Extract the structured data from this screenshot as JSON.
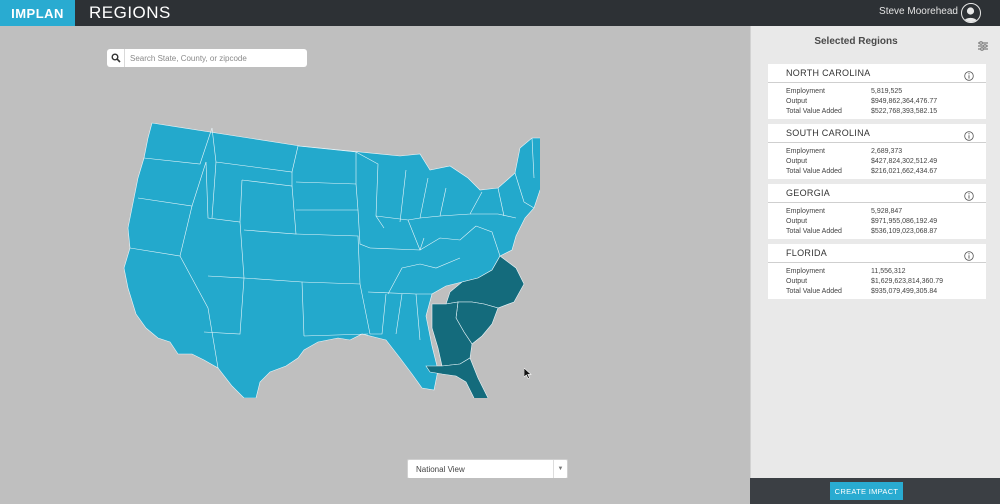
{
  "header": {
    "brand": "IMPLAN",
    "title": "REGIONS",
    "user_name": "Steve Moorehead"
  },
  "search": {
    "placeholder": "Search State, County, or zipcode",
    "value": ""
  },
  "view_select": {
    "selected": "National View"
  },
  "sidebar": {
    "title": "Selected Regions",
    "stat_labels": [
      "Employment",
      "Output",
      "Total Value Added"
    ],
    "regions": [
      {
        "name": "NORTH CAROLINA",
        "employment": "5,819,525",
        "output": "$949,862,364,476.77",
        "tva": "$522,768,393,582.15"
      },
      {
        "name": "SOUTH CAROLINA",
        "employment": "2,689,373",
        "output": "$427,824,302,512.49",
        "tva": "$216,021,662,434.67"
      },
      {
        "name": "GEORGIA",
        "employment": "5,928,847",
        "output": "$971,955,086,192.49",
        "tva": "$536,109,023,068.87"
      },
      {
        "name": "FLORIDA",
        "employment": "11,556,312",
        "output": "$1,629,623,814,360.79",
        "tva": "$935,079,499,305.84"
      }
    ]
  },
  "footer": {
    "create_label": "CREATE IMPACT"
  },
  "colors": {
    "brand": "#29abd1",
    "topbar": "#2d3135",
    "map_background": "#bfbfbf",
    "state_fill": "#23a9cc",
    "state_selected": "#146b7c",
    "sidebar_background": "#e9e9e9"
  }
}
